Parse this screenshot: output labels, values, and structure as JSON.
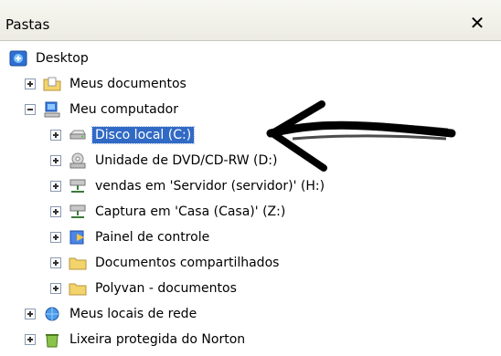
{
  "pane": {
    "title": "Pastas",
    "close_glyph": "✕"
  },
  "tree": {
    "desktop": "Desktop",
    "meus_documentos": "Meus documentos",
    "meu_computador": "Meu computador",
    "disco_local": "Disco local (C:)",
    "dvd": "Unidade de DVD/CD-RW (D:)",
    "vendas": "vendas em 'Servidor (servidor)' (H:)",
    "captura": "Captura em 'Casa (Casa)' (Z:)",
    "painel": "Painel de controle",
    "doc_compartilhados": "Documentos compartilhados",
    "polyvan": "Polyvan - documentos",
    "meus_locais": "Meus locais de rede",
    "lixeira": "Lixeira protegida do Norton"
  },
  "colors": {
    "selection": "#316ac5",
    "header_bg": "#ecebe3",
    "folder": "#f3d36b"
  },
  "icons": [
    "desktop-icon",
    "documents-folder-icon",
    "computer-icon",
    "hard-drive-icon",
    "dvd-drive-icon",
    "network-drive-icon",
    "control-panel-icon",
    "folder-icon",
    "network-places-icon",
    "recycle-bin-icon"
  ]
}
